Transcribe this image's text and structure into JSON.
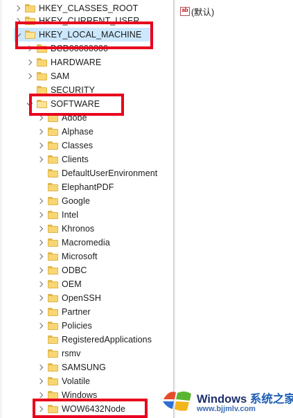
{
  "tree": {
    "items": [
      {
        "label": "HKEY_CLASSES_ROOT",
        "expanded": false,
        "selected": false
      },
      {
        "label": "HKEY_CURRENT_USER",
        "expanded": false,
        "selected": false
      },
      {
        "label": "HKEY_LOCAL_MACHINE",
        "expanded": true,
        "selected": true
      },
      {
        "label": "BCD00000000",
        "expanded": false,
        "selected": false
      },
      {
        "label": "HARDWARE",
        "expanded": false,
        "selected": false
      },
      {
        "label": "SAM",
        "expanded": false,
        "selected": false
      },
      {
        "label": "SECURITY",
        "expanded": false,
        "selected": false
      },
      {
        "label": "SOFTWARE",
        "expanded": true,
        "selected": false
      },
      {
        "label": "Adobe",
        "expanded": false,
        "selected": false
      },
      {
        "label": "Alphase",
        "expanded": false,
        "selected": false
      },
      {
        "label": "Classes",
        "expanded": false,
        "selected": false
      },
      {
        "label": "Clients",
        "expanded": false,
        "selected": false
      },
      {
        "label": "DefaultUserEnvironment",
        "expanded": false,
        "selected": false
      },
      {
        "label": "ElephantPDF",
        "expanded": false,
        "selected": false
      },
      {
        "label": "Google",
        "expanded": false,
        "selected": false
      },
      {
        "label": "Intel",
        "expanded": false,
        "selected": false
      },
      {
        "label": "Khronos",
        "expanded": false,
        "selected": false
      },
      {
        "label": "Macromedia",
        "expanded": false,
        "selected": false
      },
      {
        "label": "Microsoft",
        "expanded": false,
        "selected": false
      },
      {
        "label": "ODBC",
        "expanded": false,
        "selected": false
      },
      {
        "label": "OEM",
        "expanded": false,
        "selected": false
      },
      {
        "label": "OpenSSH",
        "expanded": false,
        "selected": false
      },
      {
        "label": "Partner",
        "expanded": false,
        "selected": false
      },
      {
        "label": "Policies",
        "expanded": false,
        "selected": false
      },
      {
        "label": "RegisteredApplications",
        "expanded": false,
        "selected": false
      },
      {
        "label": "rsmv",
        "expanded": false,
        "selected": false
      },
      {
        "label": "SAMSUNG",
        "expanded": false,
        "selected": false
      },
      {
        "label": "Volatile",
        "expanded": false,
        "selected": false
      },
      {
        "label": "Windows",
        "expanded": false,
        "selected": false
      },
      {
        "label": "WOW6432Node",
        "expanded": false,
        "selected": false
      }
    ]
  },
  "values": {
    "icon": "string-value-icon",
    "icon_text": "ab",
    "default_name": "(默认)"
  },
  "watermark": {
    "title": "Windows",
    "subtitle": "系统之家",
    "url": "www.bjjmlv.com"
  },
  "colors": {
    "highlight": "#e8001c",
    "selection": "#cce8ff",
    "folder": "#f7d673"
  }
}
